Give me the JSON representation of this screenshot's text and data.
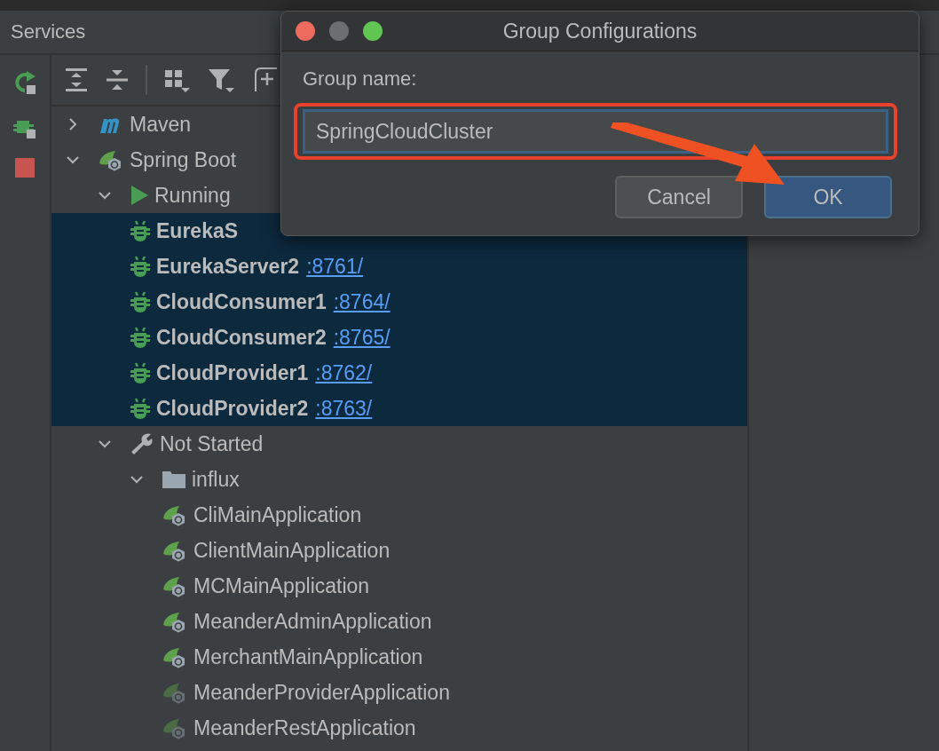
{
  "panel": {
    "title": "Services"
  },
  "tree": [
    {
      "kind": "maven",
      "label": "Maven",
      "expanded": false,
      "selected": false
    },
    {
      "kind": "springboot",
      "label": "Spring Boot",
      "expanded": true,
      "selected": false,
      "children": [
        {
          "kind": "running",
          "label": "Running",
          "expanded": true,
          "selected": false,
          "children": [
            {
              "kind": "debug-app",
              "label": "EurekaS",
              "selected": true
            },
            {
              "kind": "debug-app",
              "label": "EurekaServer2",
              "port": ":8761/",
              "selected": true
            },
            {
              "kind": "debug-app",
              "label": "CloudConsumer1",
              "port": ":8764/",
              "selected": true
            },
            {
              "kind": "debug-app",
              "label": "CloudConsumer2",
              "port": ":8765/",
              "selected": true
            },
            {
              "kind": "debug-app",
              "label": "CloudProvider1",
              "port": ":8762/",
              "selected": true
            },
            {
              "kind": "debug-app",
              "label": "CloudProvider2",
              "port": ":8763/",
              "selected": true
            }
          ]
        },
        {
          "kind": "notstarted",
          "label": "Not Started",
          "expanded": true,
          "selected": false,
          "children": [
            {
              "kind": "folder",
              "label": "influx",
              "expanded": true,
              "selected": false,
              "children": [
                {
                  "kind": "boot-app",
                  "label": "CliMainApplication",
                  "dimmed": false,
                  "selected": false
                },
                {
                  "kind": "boot-app",
                  "label": "ClientMainApplication",
                  "dimmed": false,
                  "selected": false
                },
                {
                  "kind": "boot-app",
                  "label": "MCMainApplication",
                  "dimmed": false,
                  "selected": false
                },
                {
                  "kind": "boot-app",
                  "label": "MeanderAdminApplication",
                  "dimmed": false,
                  "selected": false
                },
                {
                  "kind": "boot-app",
                  "label": "MerchantMainApplication",
                  "dimmed": false,
                  "selected": false
                },
                {
                  "kind": "boot-app",
                  "label": "MeanderProviderApplication",
                  "dimmed": true,
                  "selected": false
                },
                {
                  "kind": "boot-app",
                  "label": "MeanderRestApplication",
                  "dimmed": true,
                  "selected": false
                }
              ]
            }
          ]
        }
      ]
    }
  ],
  "dialog": {
    "title": "Group Configurations",
    "field_label": "Group name:",
    "field_value": "SpringCloudCluster",
    "buttons": [
      {
        "label": "Cancel",
        "default": false
      },
      {
        "label": "OK",
        "default": true
      }
    ]
  }
}
